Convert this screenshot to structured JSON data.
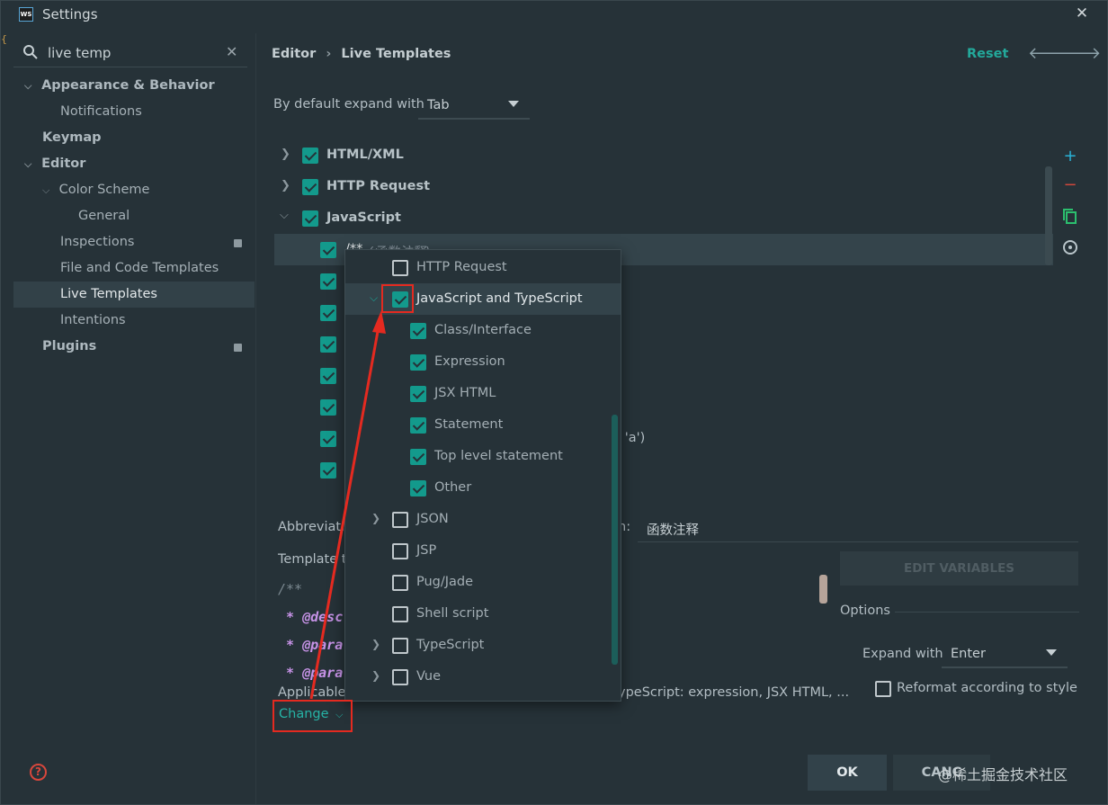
{
  "window": {
    "title": "Settings"
  },
  "search": {
    "value": "live temp"
  },
  "sidebar": {
    "items": [
      {
        "label": "Appearance & Behavior"
      },
      {
        "label": "Notifications"
      },
      {
        "label": "Keymap"
      },
      {
        "label": "Editor"
      },
      {
        "label": "Color Scheme"
      },
      {
        "label": "General"
      },
      {
        "label": "Inspections"
      },
      {
        "label": "File and Code Templates"
      },
      {
        "label": "Live Templates"
      },
      {
        "label": "Intentions"
      },
      {
        "label": "Plugins"
      }
    ]
  },
  "breadcrumb": {
    "part1": "Editor",
    "sep": "›",
    "part2": "Live Templates"
  },
  "toolbar": {
    "reset": "Reset"
  },
  "expand_default": {
    "label": "By default expand with",
    "value": "Tab"
  },
  "groups": [
    {
      "label": "HTML/XML"
    },
    {
      "label": "HTTP Request"
    },
    {
      "label": "JavaScript"
    }
  ],
  "selected_template": {
    "abbr": "/**",
    "desc": "(函数注释)"
  },
  "partial_row_text": "n 'a')",
  "abbreviation": {
    "label": "Abbreviati",
    "desc_label": "n:",
    "desc_value": "函数注释"
  },
  "template_text": {
    "label": "Template te"
  },
  "code_lines": [
    "/**",
    " * @desc",
    " * @para",
    " * @para"
  ],
  "edit_variables": "EDIT VARIABLES",
  "options": {
    "title": "Options",
    "expand_label": "Expand with",
    "expand_value": "Enter",
    "reformat_label": "Reformat according to style"
  },
  "applicable": {
    "label": "Applicable",
    "value": "ypeScript: expression, JSX HTML, ..."
  },
  "change_link": "Change",
  "popup": {
    "items": [
      {
        "label": "HTTP Request"
      },
      {
        "label": "JavaScript and TypeScript"
      },
      {
        "label": "Class/Interface"
      },
      {
        "label": "Expression"
      },
      {
        "label": "JSX HTML"
      },
      {
        "label": "Statement"
      },
      {
        "label": "Top level statement"
      },
      {
        "label": "Other"
      },
      {
        "label": "JSON"
      },
      {
        "label": "JSP"
      },
      {
        "label": "Pug/Jade"
      },
      {
        "label": "Shell script"
      },
      {
        "label": "TypeScript"
      },
      {
        "label": "Vue"
      }
    ]
  },
  "footer": {
    "ok": "OK",
    "cancel": "CANC",
    "watermark": "@稀土掘金技术社区",
    "help": "?"
  },
  "colors": {
    "accent": "#139a8c",
    "annotation": "#e42a20",
    "background": "#263238"
  }
}
